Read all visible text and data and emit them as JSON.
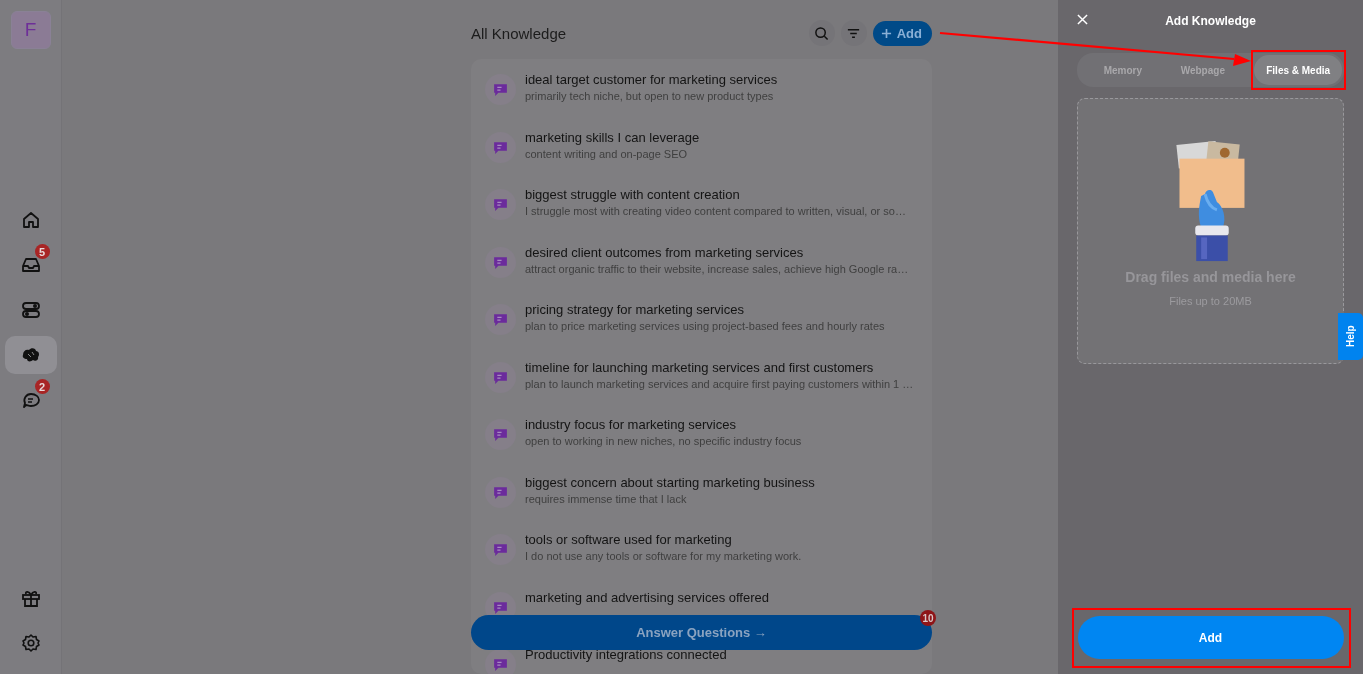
{
  "sidebar": {
    "avatar": "F",
    "items": [
      {
        "selected": false
      },
      {
        "selected": false,
        "badge": "5"
      },
      {
        "selected": false
      },
      {
        "selected": true
      },
      {
        "selected": false,
        "badge": "2"
      }
    ]
  },
  "main": {
    "title": "All Knowledge",
    "add_button": "Add",
    "pointer_arrow": true,
    "items": [
      {
        "title": "ideal target customer for marketing services",
        "subtitle": "primarily tech niche, but open to new product types"
      },
      {
        "title": "marketing skills I can leverage",
        "subtitle": "content writing and on-page SEO"
      },
      {
        "title": "biggest struggle with content creation",
        "subtitle": "I struggle most with creating video content compared to written, visual, or so…"
      },
      {
        "title": "desired client outcomes from marketing services",
        "subtitle": "attract organic traffic to their website, increase sales, achieve high Google ra…"
      },
      {
        "title": "pricing strategy for marketing services",
        "subtitle": "plan to price marketing services using project-based fees and hourly rates"
      },
      {
        "title": "timeline for launching marketing services and first customers",
        "subtitle": "plan to launch marketing services and acquire first paying customers within 1 …"
      },
      {
        "title": "industry focus for marketing services",
        "subtitle": "open to working in new niches, no specific industry focus"
      },
      {
        "title": "biggest concern about starting marketing business",
        "subtitle": "requires immense time that I lack"
      },
      {
        "title": "tools or software used for marketing",
        "subtitle": "I do not use any tools or software for my marketing work."
      },
      {
        "title": "marketing and advertising services offered"
      },
      {
        "title": "Productivity integrations connected"
      }
    ],
    "answer_button": {
      "label": "Answer Questions →",
      "badge": "10"
    }
  },
  "panel": {
    "title": "Add Knowledge",
    "tabs": [
      {
        "label": "Memory",
        "selected": false,
        "highlighted": false
      },
      {
        "label": "Webpage",
        "selected": false,
        "highlighted": false
      },
      {
        "label": "Files & Media",
        "selected": true,
        "highlighted": true
      }
    ],
    "dropzone": {
      "kind": "picture",
      "heading": "Drag files and media here",
      "note": "Files up to 20MB"
    },
    "add_button": {
      "label": "Add",
      "highlighted": true
    }
  },
  "help_tab": "Help"
}
